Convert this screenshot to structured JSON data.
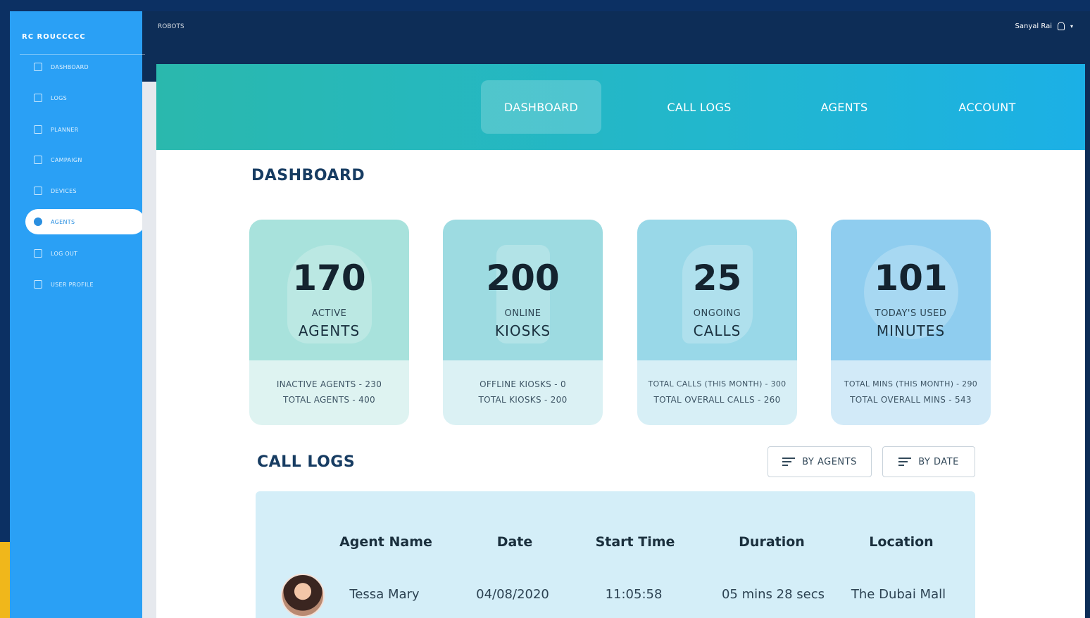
{
  "sidebar": {
    "brand": "RC  ROUCCCCC",
    "items": [
      {
        "label": "DASHBOARD",
        "icon": "grid-icon"
      },
      {
        "label": "LOGS",
        "icon": "document-icon"
      },
      {
        "label": "PLANNER",
        "icon": "calendar-icon"
      },
      {
        "label": "CAMPAIGN",
        "icon": "chart-icon"
      },
      {
        "label": "DEVICES",
        "icon": "tablet-icon"
      },
      {
        "label": "AGENTS",
        "icon": "cloud-icon"
      },
      {
        "label": "LOG OUT",
        "icon": "logout-icon"
      },
      {
        "label": "USER PROFILE",
        "icon": "user-icon"
      }
    ]
  },
  "topbar": {
    "title": "ROBOTS",
    "user_name": "Sanyal Rai"
  },
  "tabs": [
    "DASHBOARD",
    "CALL LOGS",
    "AGENTS",
    "ACCOUNT"
  ],
  "dashboard": {
    "title": "DASHBOARD",
    "cards": [
      {
        "number": "170",
        "small": "ACTIVE",
        "big": "AGENTS",
        "line1": "INACTIVE AGENTS - 230",
        "line2": "TOTAL AGENTS - 400",
        "top_color": "#a8e2dc",
        "bottom_color": "#def3f1"
      },
      {
        "number": "200",
        "small": "ONLINE",
        "big": "KIOSKS",
        "line1": "OFFLINE KIOSKS - 0",
        "line2": "TOTAL KIOSKS - 200",
        "top_color": "#9ddbe1",
        "bottom_color": "#dbf1f4"
      },
      {
        "number": "25",
        "small": "ONGOING",
        "big": "CALLS",
        "line1": "TOTAL CALLS (THIS MONTH) - 300",
        "line2": "TOTAL OVERALL CALLS - 260",
        "top_color": "#99d8e8",
        "bottom_color": "#d7eff6"
      },
      {
        "number": "101",
        "small": "TODAY'S USED",
        "big": "MINUTES",
        "line1": "TOTAL MINS (THIS MONTH) - 290",
        "line2": "TOTAL OVERALL MINS - 543",
        "top_color": "#8fcdef",
        "bottom_color": "#d2eaf8"
      }
    ]
  },
  "call_logs": {
    "title": "CALL LOGS",
    "filter_agents": "BY AGENTS",
    "filter_date": "BY DATE",
    "columns": [
      "Agent Name",
      "Date",
      "Start Time",
      "Duration",
      "Location"
    ],
    "rows": [
      {
        "agent": "Tessa Mary",
        "date": "04/08/2020",
        "start": "11:05:58",
        "duration": "05 mins 28 secs",
        "location": "The Dubai Mall"
      }
    ]
  }
}
